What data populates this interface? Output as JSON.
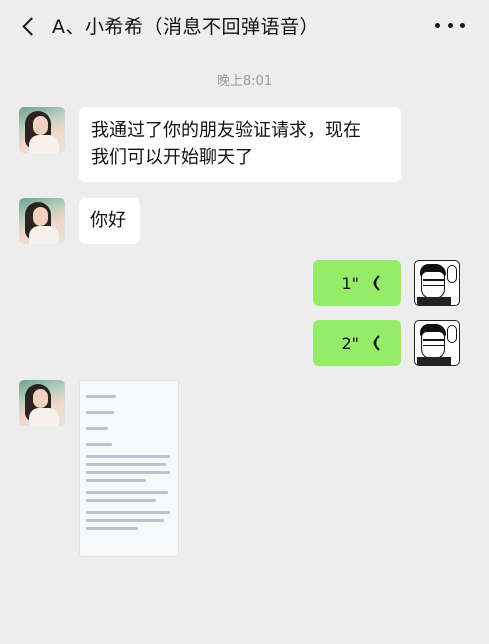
{
  "header": {
    "title": "A、小希希（消息不回弹语音）"
  },
  "timestamp": "晚上8:01",
  "messages": [
    {
      "side": "left",
      "text_line1": "我通过了你的朋友验证请求，现在",
      "text_line2": "我们可以开始聊天了"
    },
    {
      "side": "left",
      "text": "你好"
    },
    {
      "side": "right",
      "type": "voice",
      "duration": "1\""
    },
    {
      "side": "right",
      "type": "voice",
      "duration": "2\""
    },
    {
      "side": "left",
      "type": "image"
    }
  ],
  "colors": {
    "background": "#ededed",
    "incoming_bubble": "#ffffff",
    "outgoing_bubble": "#95ec69",
    "timestamp": "#9a9a9a"
  },
  "icons": {
    "back": "chevron-left-icon",
    "more": "more-dots-icon",
    "voice": "voice-wave-icon"
  }
}
